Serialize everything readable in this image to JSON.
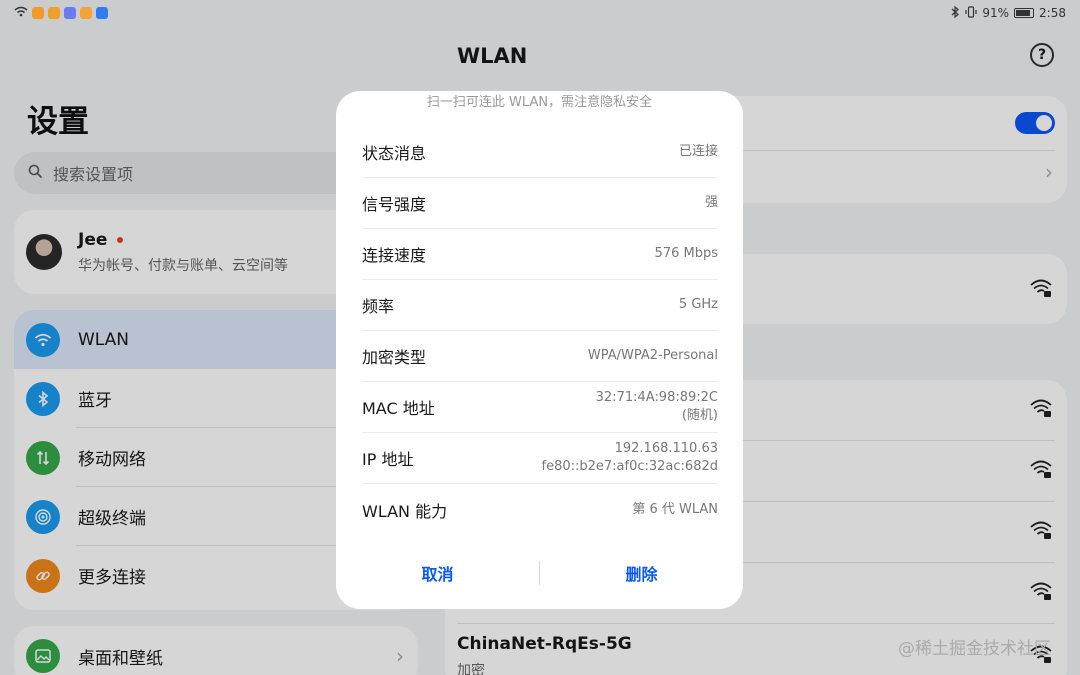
{
  "status_bar": {
    "battery": "91%",
    "time": "2:58",
    "app_icons": [
      "#f39a2b",
      "#f0a02a",
      "#6c7cf0",
      "#f2a33a",
      "#2f7bf0"
    ]
  },
  "sidebar": {
    "title": "设置",
    "search_placeholder": "搜索设置项",
    "account": {
      "name": "Jee",
      "subtitle": "华为帐号、付款与账单、云空间等"
    },
    "items": [
      {
        "label": "WLAN",
        "icon": "wifi-icon",
        "color": "#1b9bf0",
        "selected": true
      },
      {
        "label": "蓝牙",
        "icon": "bluetooth-icon",
        "color": "#1b9bf0"
      },
      {
        "label": "移动网络",
        "icon": "mobile-data-icon",
        "color": "#36a84a"
      },
      {
        "label": "超级终端",
        "icon": "super-device-icon",
        "color": "#1b9bf0"
      },
      {
        "label": "更多连接",
        "icon": "link-icon",
        "color": "#f08a1b"
      }
    ],
    "desktop": {
      "label": "桌面和壁纸",
      "icon": "wallpaper-icon",
      "color": "#36a84a"
    }
  },
  "wlan": {
    "title": "WLAN",
    "networks_visible": [
      {
        "name": "ChinaNet-RqEs-5G",
        "subtitle": "加密"
      }
    ]
  },
  "dialog": {
    "hint": "扫一扫可连此 WLAN，需注意隐私安全",
    "rows": [
      {
        "key": "状态消息",
        "value": "已连接"
      },
      {
        "key": "信号强度",
        "value": "强"
      },
      {
        "key": "连接速度",
        "value": "576 Mbps"
      },
      {
        "key": "频率",
        "value": "5 GHz"
      },
      {
        "key": "加密类型",
        "value": "WPA/WPA2-Personal"
      },
      {
        "key": "MAC 地址",
        "value": "32:71:4A:98:89:2C",
        "value2": "(随机)"
      },
      {
        "key": "IP 地址",
        "value": "192.168.110.63",
        "value2": "fe80::b2e7:af0c:32ac:682d"
      },
      {
        "key": "WLAN 能力",
        "value": "第 6 代 WLAN"
      }
    ],
    "cancel": "取消",
    "delete": "删除"
  },
  "watermark": "@稀土掘金技术社区"
}
